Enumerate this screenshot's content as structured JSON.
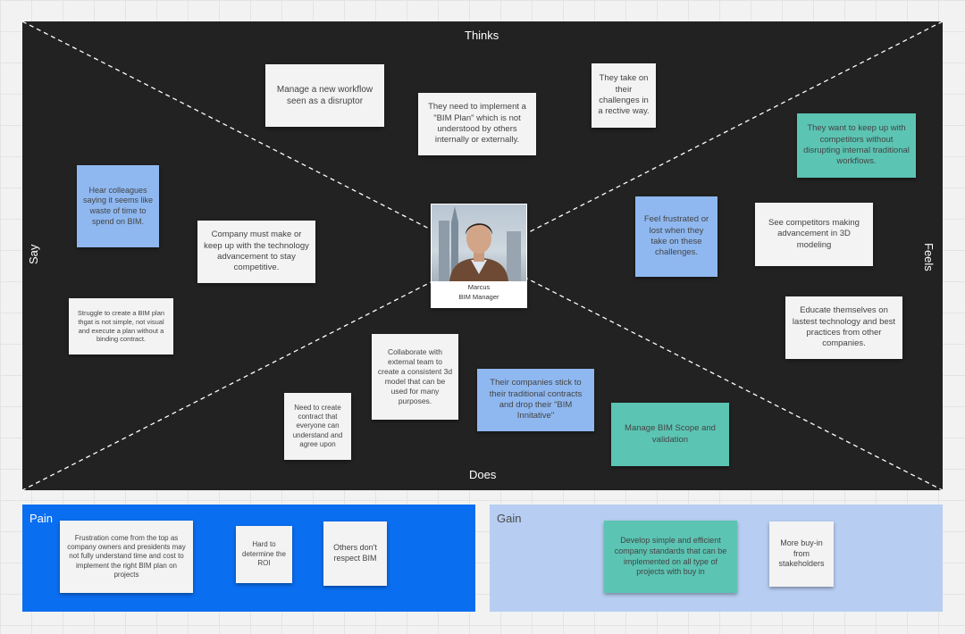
{
  "board": {
    "labels": {
      "thinks": "Thinks",
      "does": "Does",
      "say": "Say",
      "feels": "Feels"
    },
    "persona": {
      "name": "Marcus",
      "role": "BIM Manager"
    },
    "notes": {
      "n1": "Manage a new workflow seen as a disruptor",
      "n2": "They need to implement a \"BIM Plan\" which is not understood by others internally or externally.",
      "n3": "They take on their challenges in a rective way.",
      "n4": "They want to keep up with competitors without disrupting internal traditional workflows.",
      "n5": "Hear colleagues saying it seems like waste of time to spend on BIM.",
      "n6": "Company must make or keep up with the technology advancement to stay competitive.",
      "n7": "Feel frustrated or lost when they take on these challenges.",
      "n8": "See competitors making advancement in 3D modeling",
      "n9": "Struggle to create a BIM plan thgat is not simple, not visual and execute a plan without a binding contract.",
      "n10": "Educate themselves on lastest technology and best practices from other companies.",
      "n11": "Collaborate with external team to create a consistent 3d model that can be used for many purposes.",
      "n12": "Need to create contract that everyone can understand and agree upon",
      "n13": "Their companies stick to their traditional contracts and drop their \"BIM Innitative\"",
      "n14": "Manage BIM Scope and validation"
    }
  },
  "pain": {
    "title": "Pain",
    "notes": {
      "p1": "Frustration come from the top as company owners and presidents may not fully understand time and cost to implement the right BIM plan on projects",
      "p2": "Hard to determine the ROI",
      "p3": "Others don't respect BIM"
    }
  },
  "gain": {
    "title": "Gain",
    "notes": {
      "g1": "Develop simple and efficient company standards that can be implemented on all type of projects with buy in",
      "g2": "More buy-in from stakeholders"
    }
  }
}
